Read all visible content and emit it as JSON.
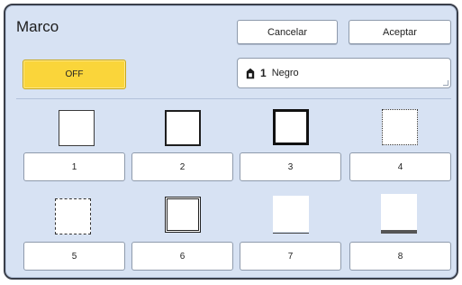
{
  "dialog": {
    "title": "Marco",
    "cancel_label": "Cancelar",
    "accept_label": "Aceptar"
  },
  "settings": {
    "off_label": "OFF",
    "drum_number": "1",
    "color_label": "Negro"
  },
  "options": [
    {
      "label": "1",
      "style": "thin-solid"
    },
    {
      "label": "2",
      "style": "medium-solid"
    },
    {
      "label": "3",
      "style": "thick-solid"
    },
    {
      "label": "4",
      "style": "dotted"
    },
    {
      "label": "5",
      "style": "dashed"
    },
    {
      "label": "6",
      "style": "double"
    },
    {
      "label": "7",
      "style": "bottom-thin"
    },
    {
      "label": "8",
      "style": "bottom-thick"
    }
  ],
  "colors": {
    "panel_bg": "#d7e2f3",
    "off_button": "#fad53a",
    "border": "#3a3f4a"
  }
}
